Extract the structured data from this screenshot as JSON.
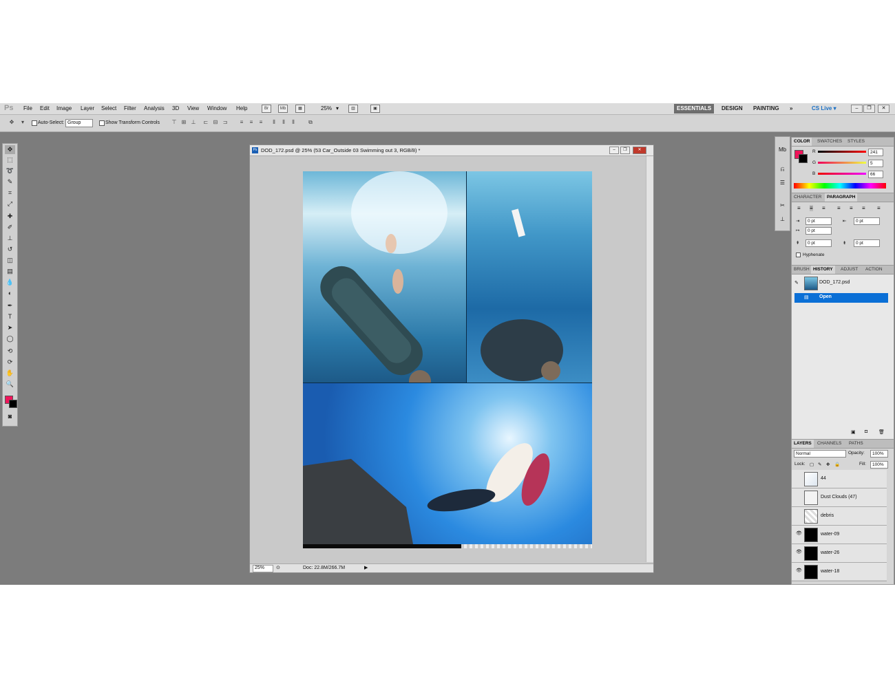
{
  "app": {
    "logo": "Ps"
  },
  "menu": [
    "File",
    "Edit",
    "Image",
    "Layer",
    "Select",
    "Filter",
    "Analysis",
    "3D",
    "View",
    "Window",
    "Help"
  ],
  "menubar_zoom": "25%",
  "workspaces": {
    "essentials": "ESSENTIALS",
    "design": "DESIGN",
    "painting": "PAINTING",
    "more": "»",
    "cslive": "CS Live ▾"
  },
  "options": {
    "auto_select_label": "Auto-Select:",
    "auto_select_value": "Group",
    "show_transform": "Show Transform Controls"
  },
  "document": {
    "title": "DOD_172.psd @ 25% (53 Car_Outside 03 Swimming out 3, RGB/8) *",
    "zoom": "25%",
    "doc_size": "Doc: 22.8M/266.7M"
  },
  "color_panel": {
    "tabs": [
      "COLOR",
      "SWATCHES",
      "STYLES"
    ],
    "r_label": "R",
    "g_label": "G",
    "b_label": "B",
    "r": "241",
    "g": "5",
    "b": "66",
    "fg": "#f0145a"
  },
  "character_panel": {
    "tabs": [
      "CHARACTER",
      "PARAGRAPH"
    ],
    "indent_left": "0 pt",
    "indent_right": "0 pt",
    "indent_first": "0 pt",
    "space_before": "0 pt",
    "space_after": "0 pt",
    "hyphenate": "Hyphenate"
  },
  "history_panel": {
    "tabs": [
      "BRUSH",
      "HISTORY",
      "ADJUST",
      "ACTION"
    ],
    "snapshot": "DOD_172.psd",
    "items": [
      "Open"
    ]
  },
  "layers_panel": {
    "tabs": [
      "LAYERS",
      "CHANNELS",
      "PATHS"
    ],
    "blend_mode": "Normal",
    "opacity_label": "Opacity:",
    "opacity": "100%",
    "lock_label": "Lock:",
    "fill_label": "Fill:",
    "fill": "100%",
    "layers": [
      {
        "name": "44",
        "visible": false
      },
      {
        "name": "Dust Clouds (47)",
        "visible": false
      },
      {
        "name": "debris",
        "visible": false
      },
      {
        "name": "water-09",
        "visible": true
      },
      {
        "name": "water-26",
        "visible": true
      },
      {
        "name": "water-18",
        "visible": true
      }
    ]
  }
}
